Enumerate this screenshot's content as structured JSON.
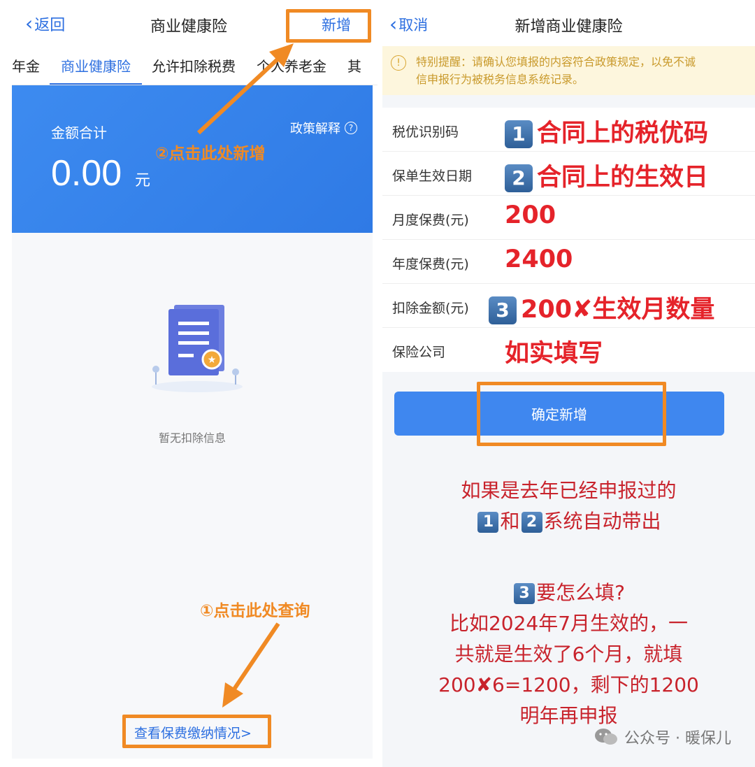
{
  "left": {
    "back_label": "返回",
    "title": "商业健康险",
    "add_label": "新增",
    "tabs": [
      "年金",
      "商业健康险",
      "允许扣除税费",
      "个人养老金",
      "其"
    ],
    "sum_label": "金额合计",
    "policy_label": "政策解释",
    "amount": "0.00",
    "unit": "元",
    "empty_text": "暂无扣除信息",
    "view_link": "查看保费缴纳情况>",
    "annotation_add": "②点击此处新增",
    "annotation_query": "①点击此处查询"
  },
  "right": {
    "cancel_label": "取消",
    "title": "新增商业健康险",
    "notice_line1": "特别提醒：请确认您填报的内容符合政策规定，以免不诚",
    "notice_line2": "信申报行为被税务信息系统记录。",
    "rows": [
      {
        "label": "税优识别码",
        "badge": "1",
        "value": "合同上的税优码"
      },
      {
        "label": "保单生效日期",
        "badge": "2",
        "value": "合同上的生效日"
      },
      {
        "label": "月度保费(元)",
        "badge": "",
        "value": "200"
      },
      {
        "label": "年度保费(元)",
        "badge": "",
        "value": "2400"
      },
      {
        "label": "扣除金额(元)",
        "badge": "3",
        "value": "200✘生效月数量"
      },
      {
        "label": "保险公司",
        "badge": "",
        "value": "如实填写"
      }
    ],
    "confirm_label": "确定新增",
    "note1_line1": "如果是去年已经申报过的",
    "note1_badge1": "1",
    "note1_mid": "和",
    "note1_badge2": "2",
    "note1_tail": "系统自动带出",
    "note2_badge": "3",
    "note2_title": "要怎么填?",
    "note2_line1": "比如2024年7月生效的，一",
    "note2_line2": "共就是生效了6个月，就填",
    "note2_line3": "200✘6=1200，剩下的1200",
    "note2_line4": "明年再申报",
    "watermark": "公众号 · 暖保儿"
  },
  "colors": {
    "accent": "#2d6fe0",
    "annotation": "#f08a24",
    "red_text": "#e5232a",
    "notice_bg": "#fdf6dd"
  }
}
